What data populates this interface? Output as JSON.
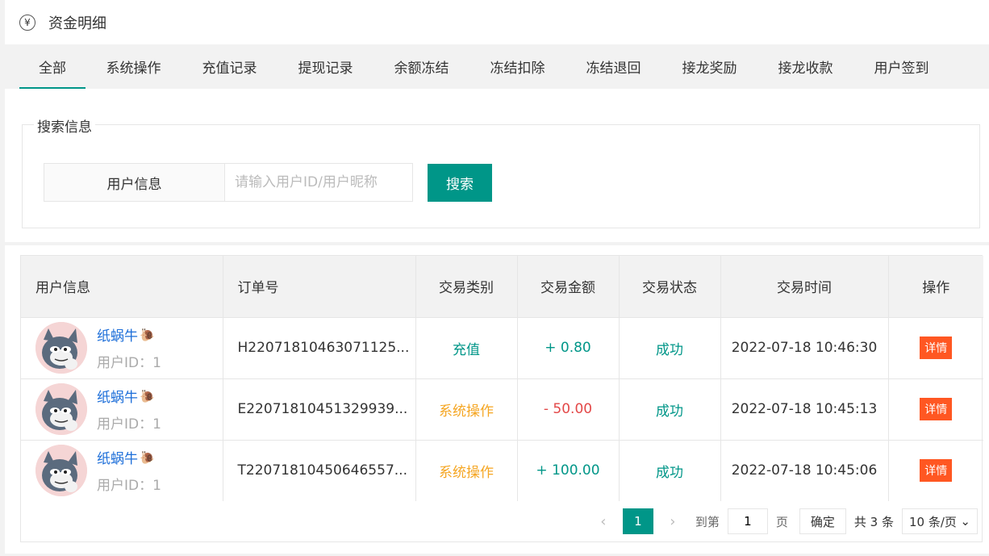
{
  "header": {
    "icon": "yen-icon",
    "icon_glyph": "¥",
    "title": "资金明细"
  },
  "tabs": [
    {
      "label": "全部",
      "active": true
    },
    {
      "label": "系统操作",
      "active": false
    },
    {
      "label": "充值记录",
      "active": false
    },
    {
      "label": "提现记录",
      "active": false
    },
    {
      "label": "余额冻结",
      "active": false
    },
    {
      "label": "冻结扣除",
      "active": false
    },
    {
      "label": "冻结退回",
      "active": false
    },
    {
      "label": "接龙奖励",
      "active": false
    },
    {
      "label": "接龙收款",
      "active": false
    },
    {
      "label": "用户签到",
      "active": false
    }
  ],
  "search": {
    "legend": "搜索信息",
    "label": "用户信息",
    "placeholder": "请输入用户ID/用户昵称",
    "value": "",
    "button": "搜索"
  },
  "table": {
    "columns": [
      "用户信息",
      "订单号",
      "交易类别",
      "交易金额",
      "交易状态",
      "交易时间",
      "操作"
    ],
    "rows": [
      {
        "name": "纸蜗牛",
        "snail": "🐌",
        "uid": "用户ID：1",
        "order": "H22071810463071125...",
        "type": "充值",
        "type_kind": "recharge",
        "amount": "+ 0.80",
        "amount_kind": "plus",
        "status": "成功",
        "time": "2022-07-18 10:46:30",
        "action": "详情"
      },
      {
        "name": "纸蜗牛",
        "snail": "🐌",
        "uid": "用户ID：1",
        "order": "E22071810451329939...",
        "type": "系统操作",
        "type_kind": "system",
        "amount": "- 50.00",
        "amount_kind": "minus",
        "status": "成功",
        "time": "2022-07-18 10:45:13",
        "action": "详情"
      },
      {
        "name": "纸蜗牛",
        "snail": "🐌",
        "uid": "用户ID：1",
        "order": "T22071810450646557...",
        "type": "系统操作",
        "type_kind": "system",
        "amount": "+ 100.00",
        "amount_kind": "plus",
        "status": "成功",
        "time": "2022-07-18 10:45:06",
        "action": "详情"
      }
    ]
  },
  "pager": {
    "prev": "‹",
    "current": "1",
    "next": "›",
    "goto_label": "到第",
    "goto_value": "1",
    "page_unit": "页",
    "confirm": "确定",
    "total": "共 3 条",
    "page_size": "10 条/页",
    "page_size_arrow": "⌄"
  },
  "colors": {
    "accent": "#009688",
    "danger": "#ff5722",
    "warning": "#f5a623",
    "link": "#1e6fd9"
  }
}
